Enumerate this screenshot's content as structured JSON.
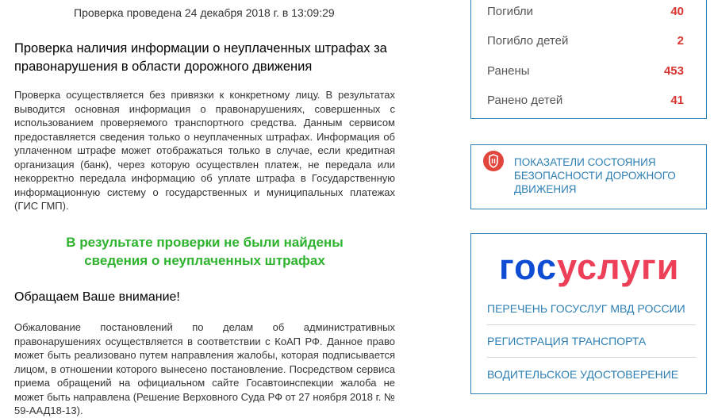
{
  "check": {
    "date_text": "Проверка проведена 24 декабря 2018 г. в 13:09:29",
    "heading": "Проверка наличия информации о неуплаченных штрафах за правонарушения в области дорожного движения",
    "description": "Проверка осуществляется без привязки к конкретному лицу. В результатах выводится основная информация о правонарушениях, совершенных с использованием проверяемого транспортного средства. Данным сервисом предоставляется сведения только о неуплаченных штрафах. Информация об уплаченном штрафе может отображаться только в случае, если кредитная организация (банк), через которую осуществлен платеж, не передала или некорректно передала информацию об уплате штрафа в Государственную информационную систему о государственных и муниципальных платежах (ГИС ГМП).",
    "result_line1": "В результате проверки не были найдены",
    "result_line2": "сведения о неуплаченных штрафах",
    "attention": "Обращаем Ваше внимание!",
    "appeal_text": "Обжалование постановлений по делам об административных правонарушениях осуществляется в соответствии с КоАП РФ. Данное право может быть реализовано путем направления жалобы, которая подписывается лицом, в отношении которого вынесено постановление. Посредством сервиса приема обращений на официальном сайте Госавтоинспекции жалоба не может быть направлена (Решение Верховного Суда РФ от 27 ноября 2018 г. № 59-ААД18-13)."
  },
  "stats": {
    "items": [
      {
        "label": "Погибли",
        "value": "40"
      },
      {
        "label": "Погибло детей",
        "value": "2"
      },
      {
        "label": "Ранены",
        "value": "453"
      },
      {
        "label": "Ранено детей",
        "value": "41"
      }
    ],
    "value_color": "#d9352f"
  },
  "safety": {
    "link_text": "Показатели состояния безопасности дорожного движения",
    "icon": "road-safety-icon"
  },
  "gosuslugi": {
    "logo_part1": "гос",
    "logo_part2": "услуги",
    "links": [
      "Перечень госуслуг МВД России",
      "Регистрация транспорта",
      "Водительское удостоверение"
    ]
  },
  "colors": {
    "accent": "#2d7fb3",
    "success": "#2db32d",
    "logo_blue": "#0d4cd3",
    "logo_red": "#ee3f58"
  }
}
